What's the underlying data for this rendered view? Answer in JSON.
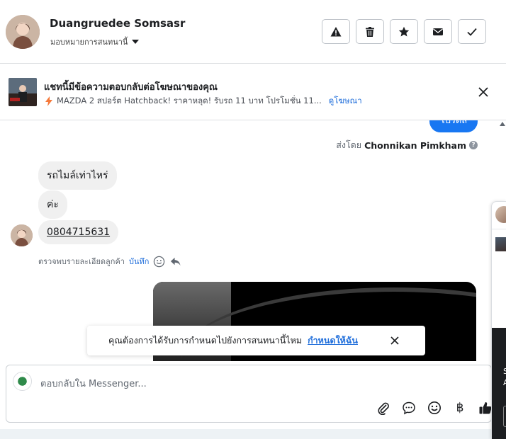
{
  "header": {
    "contact_name": "Duangruedee Somsasr",
    "assign_label": "มอบหมายการสนทนานี้",
    "actions": [
      "spam-icon",
      "trash-icon",
      "star-icon",
      "mail-icon",
      "check-icon"
    ]
  },
  "ad_banner": {
    "title": "แชทนี้มีข้อความตอบกลับต่อโฆษณาของคุณ",
    "ad_text": "MAZDA 2 สปอร์ต Hatchback! ราคาหลุด! รับรถ 11 บาท โปรโมชั่น 11...",
    "view_ad_link": "ดูโฆษณา"
  },
  "chat": {
    "sent_bubble_text": "โปรดส",
    "sent_by_label": "ส่งโดย",
    "sent_by_name": "Chonnikan Pimkham",
    "messages": [
      "รถไมล์เท่าไหร่",
      "ค่ะ",
      "0804715631"
    ],
    "meta_text": "ตรวจพบรายละเอียดลูกค้า",
    "meta_save": "บันทึก"
  },
  "toast": {
    "text": "คุณต้องการได้รับการกำหนดไปยังการสนทนานี้ไหม",
    "link": "กำหนดให้ฉัน"
  },
  "composer": {
    "placeholder": "ตอบกลับใน Messenger...",
    "tools": [
      "attach-icon",
      "saved-reply-icon",
      "emoji-icon",
      "baht-icon",
      "like-icon"
    ],
    "baht_symbol": "฿"
  },
  "side_peek": {
    "text_lines": [
      "S",
      "A"
    ]
  },
  "colors": {
    "accent_blue": "#1877f2",
    "link_blue": "#216fdb",
    "bubble_gray": "#f0f0f0"
  }
}
